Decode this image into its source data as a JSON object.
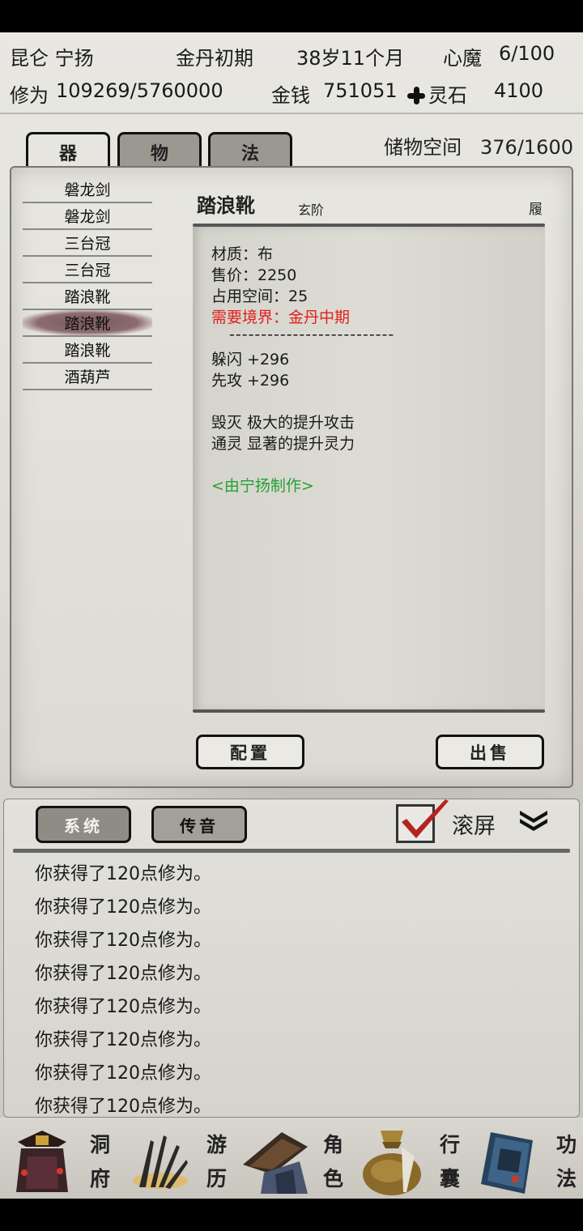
{
  "header": {
    "location_name": "昆仑 宁扬",
    "realm": "金丹初期",
    "age": "38岁11个月",
    "heart_demon_label": "心魔",
    "heart_demon_value": "6/100",
    "cultivation_label": "修为",
    "cultivation_value": "109269/5760000",
    "money_label": "金钱",
    "money_value": "751051",
    "spirit_stone_label": "灵石",
    "spirit_stone_value": "4100"
  },
  "tabs": [
    {
      "label": "器",
      "active": true
    },
    {
      "label": "物",
      "active": false
    },
    {
      "label": "法",
      "active": false
    }
  ],
  "storage": {
    "label": "储物空间",
    "value": "376/1600"
  },
  "items": [
    {
      "name": "磐龙剑",
      "selected": false
    },
    {
      "name": "磐龙剑",
      "selected": false
    },
    {
      "name": "三台冠",
      "selected": false
    },
    {
      "name": "三台冠",
      "selected": false
    },
    {
      "name": "踏浪靴",
      "selected": false
    },
    {
      "name": "踏浪靴",
      "selected": true
    },
    {
      "name": "踏浪靴",
      "selected": false
    },
    {
      "name": "酒葫芦",
      "selected": false
    }
  ],
  "detail": {
    "title": "踏浪靴",
    "grade": "玄阶",
    "slot": "履",
    "material": "材质：布",
    "price": "售价：2250",
    "space": "占用空间：25",
    "requirement": "需要境界：金丹中期",
    "divider": "--------------------------",
    "stat1": "躲闪 +296",
    "stat2": "先攻 +296",
    "effect1": "毁灭 极大的提升攻击",
    "effect2": "通灵 显著的提升灵力",
    "maker": "<由宁扬制作>"
  },
  "actions": {
    "equip_label": "配置",
    "sell_label": "出售"
  },
  "log": {
    "tab_system": "系统",
    "tab_message": "传音",
    "scroll_label": "滚屏",
    "scroll_checked": true,
    "lines": [
      "你获得了120点修为。",
      "你获得了120点修为。",
      "你获得了120点修为。",
      "你获得了120点修为。",
      "你获得了120点修为。",
      "你获得了120点修为。",
      "你获得了120点修为。",
      "你获得了120点修为。"
    ]
  },
  "nav": [
    {
      "c1": "洞",
      "c2": "府",
      "icon": "cave-residence-icon"
    },
    {
      "c1": "游",
      "c2": "历",
      "icon": "travel-icon"
    },
    {
      "c1": "角",
      "c2": "色",
      "icon": "character-icon"
    },
    {
      "c1": "行",
      "c2": "囊",
      "icon": "bag-icon"
    },
    {
      "c1": "功",
      "c2": "法",
      "icon": "technique-book-icon"
    }
  ]
}
